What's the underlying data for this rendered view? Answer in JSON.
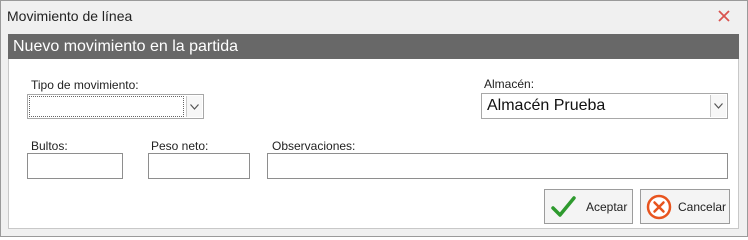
{
  "window": {
    "title": "Movimiento de línea"
  },
  "header": {
    "title": "Nuevo movimiento en la partida"
  },
  "form": {
    "tipo_movimiento": {
      "label": "Tipo de movimiento:",
      "value": ""
    },
    "almacen": {
      "label": "Almacén:",
      "value": "Almacén Prueba"
    },
    "bultos": {
      "label": "Bultos:",
      "value": ""
    },
    "peso_neto": {
      "label": "Peso neto:",
      "value": ""
    },
    "observaciones": {
      "label": "Observaciones:",
      "value": ""
    }
  },
  "buttons": {
    "accept_label": "Aceptar",
    "cancel_label": "Cancelar"
  },
  "colors": {
    "header_band": "#686868",
    "accept_check": "#2e9a2e",
    "cancel_circle": "#e8541e",
    "close_x": "#d9534f"
  },
  "icons": {
    "close": "close-icon",
    "accept": "check-icon",
    "cancel": "cancel-circle-icon",
    "dropdown": "chevron-down-icon"
  }
}
